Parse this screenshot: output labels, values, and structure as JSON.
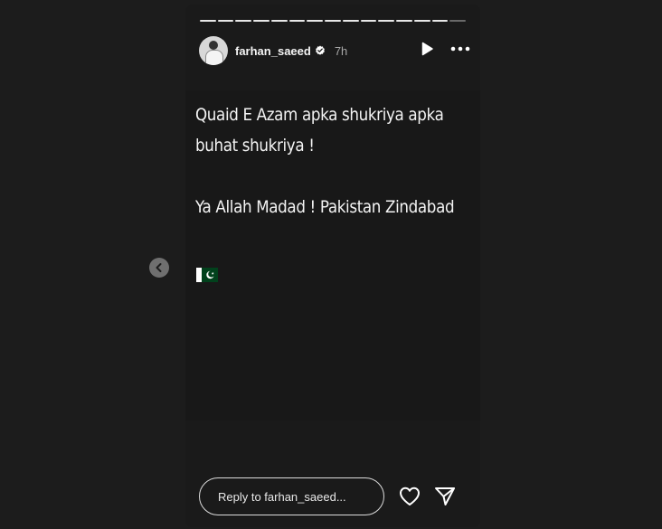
{
  "story": {
    "progress_segments": 15,
    "current_segment": 15,
    "user": {
      "username": "farhan_saeed",
      "time": "7h",
      "verified": true
    },
    "caption_lines": [
      "Quaid E Azam apka shukriya apka",
      "buhat shukriya !",
      "",
      "Ya Allah Madad ! Pakistan Zindabad",
      "",
      ""
    ],
    "flag_emoji": "pakistan-flag-icon"
  },
  "reply": {
    "placeholder": "Reply to farhan_saeed..."
  },
  "icons": {
    "play": "play-icon",
    "more": "more-options-icon",
    "heart": "heart-icon",
    "share": "paper-plane-icon",
    "prev": "chevron-left-icon"
  },
  "colors": {
    "background": "#1c1c1c",
    "story_bg": "#1a1a1a",
    "text": "#f4f4f4",
    "muted": "#a8a8a8",
    "verified_badge": "#ffffff",
    "flag_green": "#01411c"
  }
}
